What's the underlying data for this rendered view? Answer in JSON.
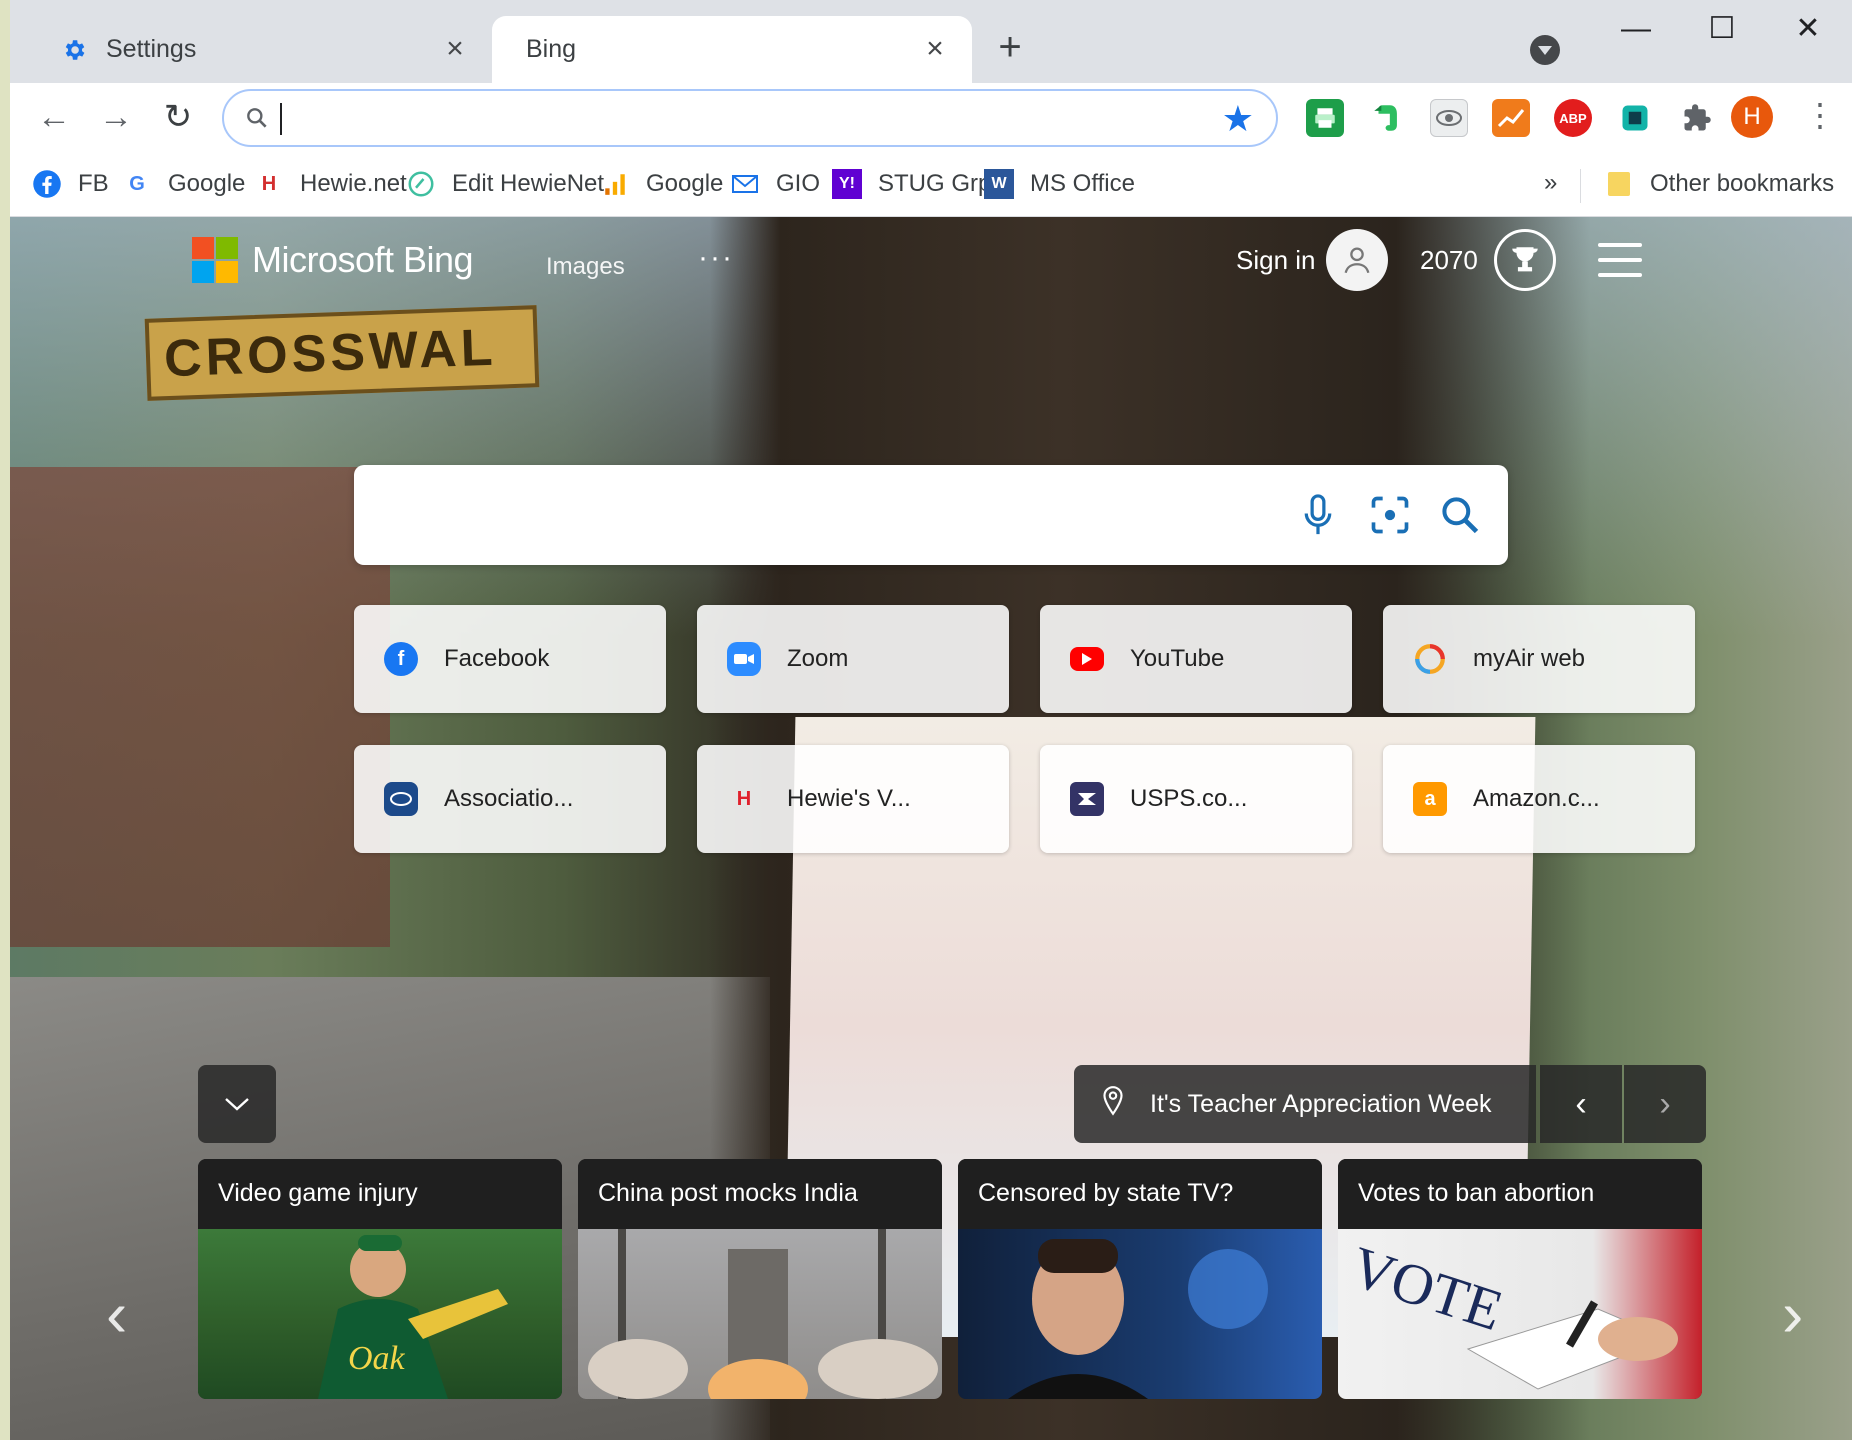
{
  "tabs": [
    {
      "title": "Settings",
      "icon": "gear-icon",
      "active": false
    },
    {
      "title": "Bing",
      "icon": "",
      "active": true
    }
  ],
  "toolbar": {
    "address_value": "",
    "extensions": [
      "printer-icon",
      "evernote-icon",
      "eye-icon",
      "chart-icon",
      "ABP",
      "screenshot-icon",
      "puzzle-icon"
    ],
    "profile_initial": "H"
  },
  "bookmarks": [
    {
      "label": "FB",
      "icon": "facebook-icon"
    },
    {
      "label": "Google",
      "icon": "google-icon"
    },
    {
      "label": "Hewie.net",
      "icon": "hewie-icon"
    },
    {
      "label": "Edit HewieNet",
      "icon": "edit-icon"
    },
    {
      "label": "Google",
      "icon": "analytics-icon"
    },
    {
      "label": "GIO",
      "icon": "mail-icon"
    },
    {
      "label": "STUG Grp",
      "icon": "yahoo-icon"
    },
    {
      "label": "MS Office",
      "icon": "word-icon"
    }
  ],
  "bookmarks_more": "»",
  "other_bookmarks": "Other bookmarks",
  "bing": {
    "logo_text": "Microsoft Bing",
    "nav_images": "Images",
    "nav_more": "···",
    "sign_in": "Sign in",
    "rewards_points": "2070",
    "background_sign_text": "CROSSWAL"
  },
  "quick_links": [
    {
      "label": "Facebook",
      "icon": "facebook-icon",
      "color": "#1877f2"
    },
    {
      "label": "Zoom",
      "icon": "zoom-icon",
      "color": "#2d8cff"
    },
    {
      "label": "YouTube",
      "icon": "youtube-icon",
      "color": "#ff0000"
    },
    {
      "label": "myAir web",
      "icon": "myair-icon",
      "color": "#f5a623"
    },
    {
      "label": "Associatio...",
      "icon": "association-icon",
      "color": "#1c4a8a"
    },
    {
      "label": "Hewie's V...",
      "icon": "hewie-icon",
      "color": "#e0202c"
    },
    {
      "label": "USPS.co...",
      "icon": "usps-icon",
      "color": "#333366"
    },
    {
      "label": "Amazon.c...",
      "icon": "amazon-icon",
      "color": "#ff9900"
    }
  ],
  "image_caption": "It's Teacher Appreciation Week",
  "news": [
    {
      "title": "Video game injury"
    },
    {
      "title": "China post mocks India"
    },
    {
      "title": "Censored by state TV?"
    },
    {
      "title": "Votes to ban abortion"
    }
  ],
  "colors": {
    "accent_blue": "#1a73e8",
    "profile_orange": "#e8580c",
    "tabstrip_bg": "#dee1e6"
  }
}
